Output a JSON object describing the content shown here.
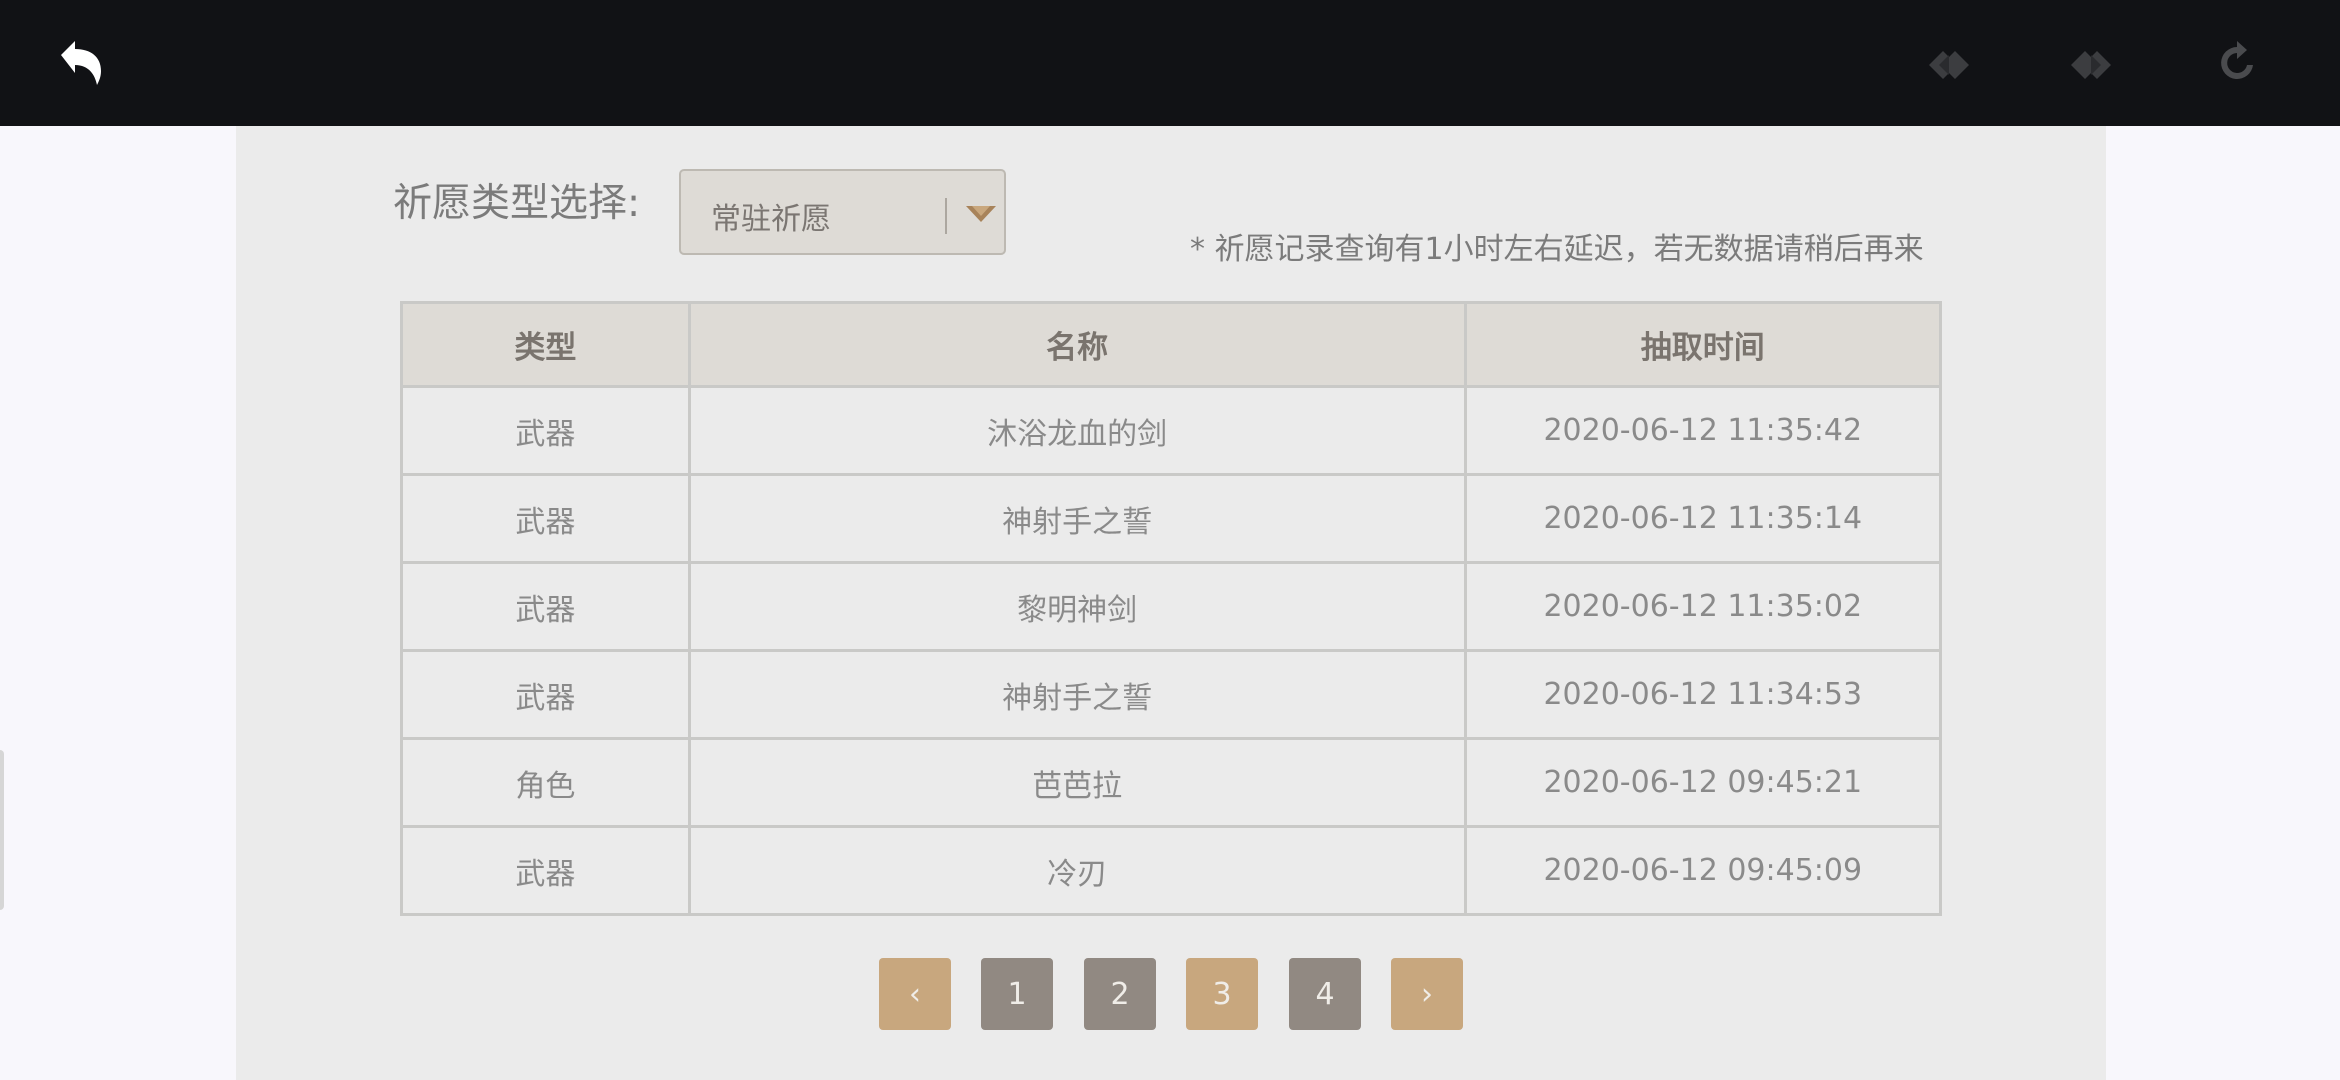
{
  "topbar": {
    "back_icon": "undo-arrow-icon",
    "prev_icon": "prev-diamond-icon",
    "next_icon": "next-diamond-icon",
    "refresh_icon": "refresh-icon"
  },
  "filter": {
    "label": "祈愿类型选择:",
    "selected": "常驻祈愿",
    "note": "* 祈愿记录查询有1小时左右延迟，若无数据请稍后再来"
  },
  "table": {
    "headers": [
      "类型",
      "名称",
      "抽取时间"
    ],
    "rows": [
      {
        "type": "武器",
        "name": "沐浴龙血的剑",
        "time": "2020-06-12 11:35:42"
      },
      {
        "type": "武器",
        "name": "神射手之誓",
        "time": "2020-06-12 11:35:14"
      },
      {
        "type": "武器",
        "name": "黎明神剑",
        "time": "2020-06-12 11:35:02"
      },
      {
        "type": "武器",
        "name": "神射手之誓",
        "time": "2020-06-12 11:34:53"
      },
      {
        "type": "角色",
        "name": "芭芭拉",
        "time": "2020-06-12 09:45:21"
      },
      {
        "type": "武器",
        "name": "冷刃",
        "time": "2020-06-12 09:45:09"
      }
    ]
  },
  "pagination": {
    "prev": "‹",
    "pages": [
      "1",
      "2",
      "3",
      "4"
    ],
    "next": "›",
    "current": "3"
  },
  "colors": {
    "topbar": "#111215",
    "panel": "#ebebeb",
    "accent_tan": "#c8a77e",
    "page_gray": "#918982"
  }
}
